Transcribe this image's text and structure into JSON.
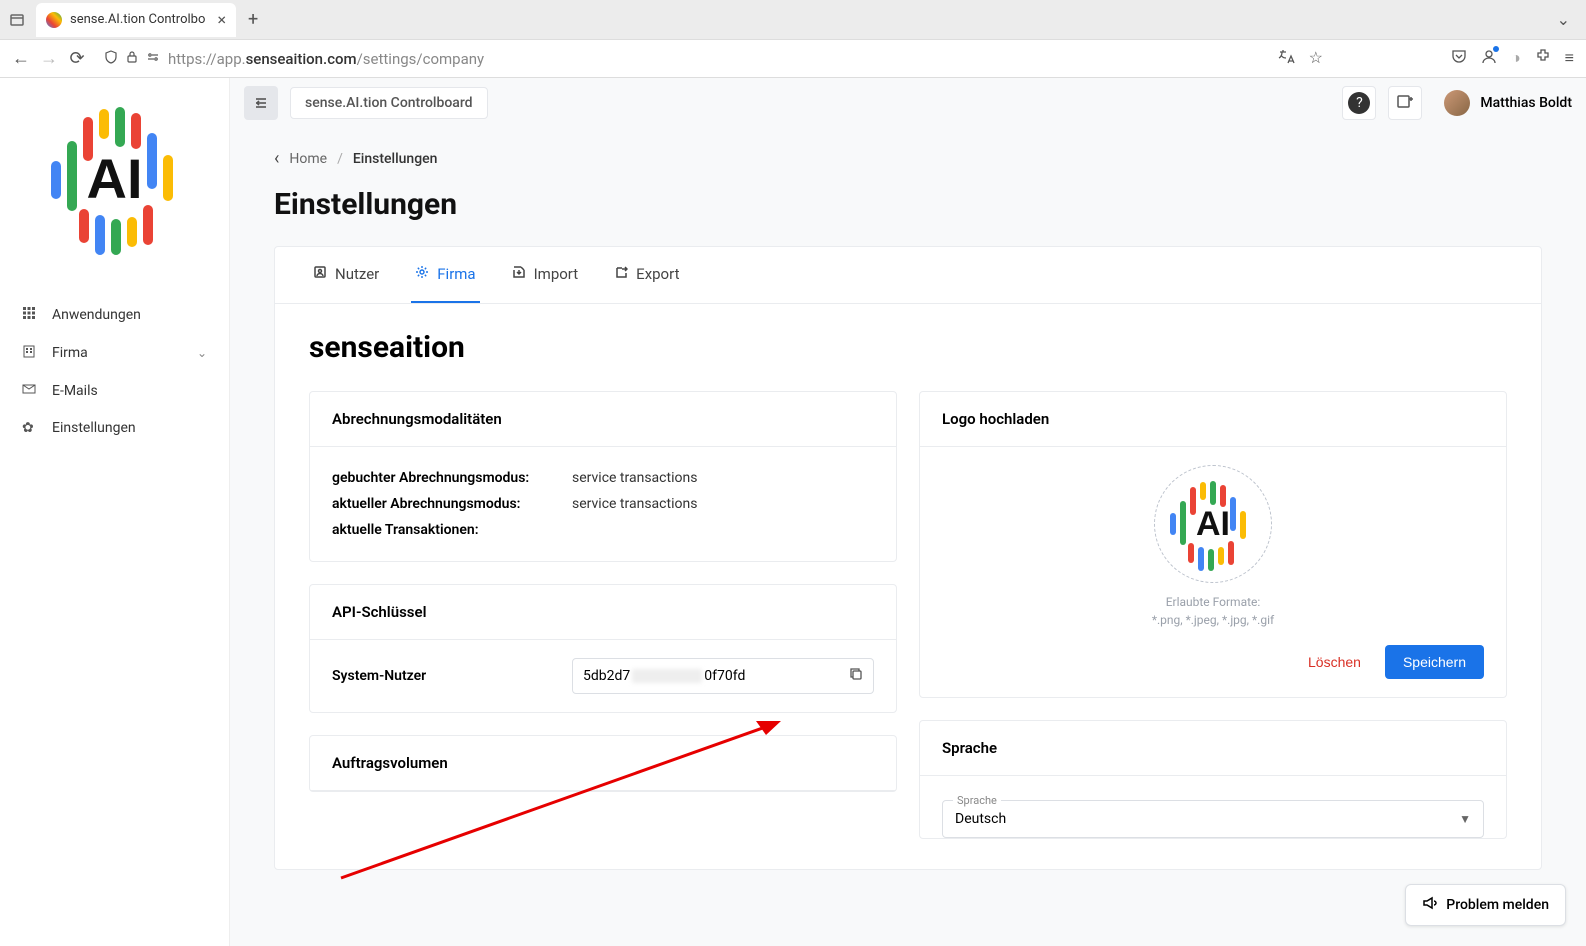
{
  "browser": {
    "tab_title": "sense.AI.tion Controlbo",
    "url_prefix": "https://app.",
    "url_host": "senseaition.com",
    "url_path": "/settings/company"
  },
  "header": {
    "app_name": "sense.AI.tion Controlboard",
    "user_name": "Matthias Boldt"
  },
  "sidebar": {
    "items": [
      {
        "label": "Anwendungen",
        "icon": "grid"
      },
      {
        "label": "Firma",
        "icon": "building",
        "expandable": true
      },
      {
        "label": "E-Mails",
        "icon": "mail"
      },
      {
        "label": "Einstellungen",
        "icon": "gear"
      }
    ]
  },
  "breadcrumbs": {
    "home": "Home",
    "current": "Einstellungen"
  },
  "page_title": "Einstellungen",
  "tabs": [
    {
      "label": "Nutzer",
      "icon": "user"
    },
    {
      "label": "Firma",
      "icon": "gear",
      "active": true
    },
    {
      "label": "Import",
      "icon": "import"
    },
    {
      "label": "Export",
      "icon": "export"
    }
  ],
  "company_name": "senseaition",
  "billing": {
    "title": "Abrechnungsmodalitäten",
    "rows": [
      {
        "k": "gebuchter Abrechnungsmodus:",
        "v": "service transactions"
      },
      {
        "k": "aktueller Abrechnungsmodus:",
        "v": "service transactions"
      },
      {
        "k": "aktuelle Transaktionen:",
        "v": ""
      }
    ]
  },
  "api": {
    "title": "API-Schlüssel",
    "label": "System-Nutzer",
    "value_prefix": "5db2d7",
    "value_suffix": "0f70fd"
  },
  "volume": {
    "title": "Auftragsvolumen"
  },
  "logo_upload": {
    "title": "Logo hochladen",
    "hint1": "Erlaubte Formate:",
    "hint2": "*.png, *.jpeg, *.jpg, *.gif",
    "delete_label": "Löschen",
    "save_label": "Speichern"
  },
  "language": {
    "title": "Sprache",
    "field_label": "Sprache",
    "value": "Deutsch"
  },
  "report_label": "Problem melden"
}
